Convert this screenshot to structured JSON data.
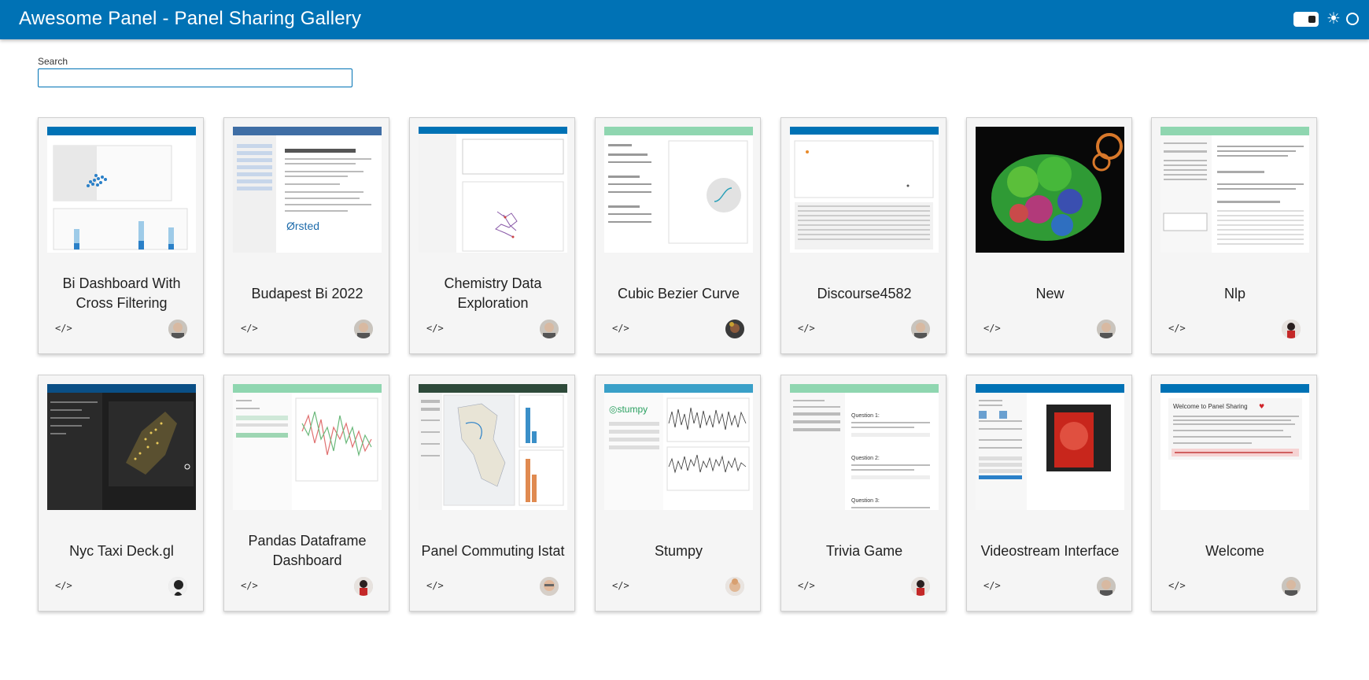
{
  "header": {
    "title": "Awesome Panel  -  Panel Sharing Gallery"
  },
  "search": {
    "label": "Search",
    "value": "",
    "placeholder": ""
  },
  "colors": {
    "header_bg": "#0072b5",
    "card_bg": "#f5f5f5"
  },
  "icons": {
    "code": "code-icon",
    "theme_toggle": "toggle-icon",
    "sun": "sun-icon",
    "busy": "circle-indicator-icon"
  },
  "gallery": {
    "rows": [
      [
        {
          "title": "Bi Dashboard With Cross Filtering",
          "code_glyph": "</>"
        },
        {
          "title": "Budapest Bi 2022",
          "code_glyph": "</>"
        },
        {
          "title": "Chemistry Data Exploration",
          "code_glyph": "</>"
        },
        {
          "title": "Cubic Bezier Curve",
          "code_glyph": "</>"
        },
        {
          "title": "Discourse4582",
          "code_glyph": "</>"
        },
        {
          "title": "New",
          "code_glyph": "</>"
        },
        {
          "title": "Nlp",
          "code_glyph": "</>"
        }
      ],
      [
        {
          "title": "Nyc Taxi Deck.gl",
          "code_glyph": "</>"
        },
        {
          "title": "Pandas Dataframe Dashboard",
          "code_glyph": "</>"
        },
        {
          "title": "Panel Commuting Istat",
          "code_glyph": "</>"
        },
        {
          "title": "Stumpy",
          "code_glyph": "</>"
        },
        {
          "title": "Trivia Game",
          "code_glyph": "</>"
        },
        {
          "title": "Videostream Interface",
          "code_glyph": "</>"
        },
        {
          "title": "Welcome",
          "code_glyph": "</>"
        }
      ]
    ]
  }
}
